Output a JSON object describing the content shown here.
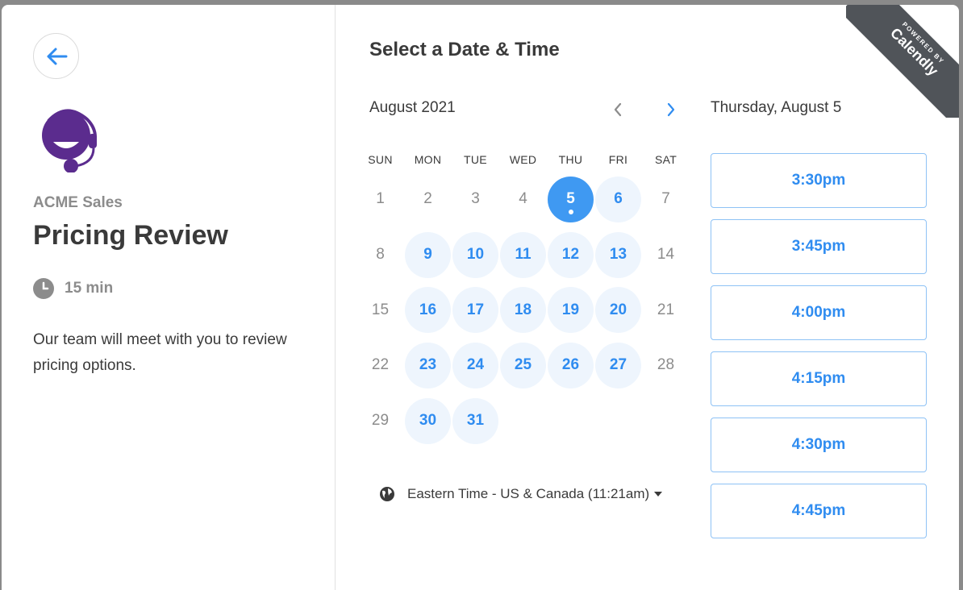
{
  "organizer": {
    "name": "ACME Sales",
    "event_title": "Pricing Review",
    "duration": "15 min",
    "description": "Our team will meet with you to review pricing options.",
    "brand_color": "#5b2c8e"
  },
  "scheduler": {
    "title": "Select a Date & Time",
    "month": "August 2021",
    "weekdays": [
      "SUN",
      "MON",
      "TUE",
      "WED",
      "THU",
      "FRI",
      "SAT"
    ],
    "selected_date_label": "Thursday, August 5",
    "timezone_label": "Eastern Time - US & Canada (11:21am)",
    "days": [
      {
        "n": "1",
        "state": "disabled"
      },
      {
        "n": "2",
        "state": "disabled"
      },
      {
        "n": "3",
        "state": "disabled"
      },
      {
        "n": "4",
        "state": "disabled"
      },
      {
        "n": "5",
        "state": "selected"
      },
      {
        "n": "6",
        "state": "available"
      },
      {
        "n": "7",
        "state": "disabled"
      },
      {
        "n": "8",
        "state": "disabled"
      },
      {
        "n": "9",
        "state": "available"
      },
      {
        "n": "10",
        "state": "available"
      },
      {
        "n": "11",
        "state": "available"
      },
      {
        "n": "12",
        "state": "available"
      },
      {
        "n": "13",
        "state": "available"
      },
      {
        "n": "14",
        "state": "disabled"
      },
      {
        "n": "15",
        "state": "disabled"
      },
      {
        "n": "16",
        "state": "available"
      },
      {
        "n": "17",
        "state": "available"
      },
      {
        "n": "18",
        "state": "available"
      },
      {
        "n": "19",
        "state": "available"
      },
      {
        "n": "20",
        "state": "available"
      },
      {
        "n": "21",
        "state": "disabled"
      },
      {
        "n": "22",
        "state": "disabled"
      },
      {
        "n": "23",
        "state": "available"
      },
      {
        "n": "24",
        "state": "available"
      },
      {
        "n": "25",
        "state": "available"
      },
      {
        "n": "26",
        "state": "available"
      },
      {
        "n": "27",
        "state": "available"
      },
      {
        "n": "28",
        "state": "disabled"
      },
      {
        "n": "29",
        "state": "disabled"
      },
      {
        "n": "30",
        "state": "available"
      },
      {
        "n": "31",
        "state": "available"
      }
    ],
    "time_slots": [
      "3:30pm",
      "3:45pm",
      "4:00pm",
      "4:15pm",
      "4:30pm",
      "4:45pm"
    ]
  },
  "badge": {
    "small_text": "POWERED BY",
    "brand_text": "Calendly"
  },
  "colors": {
    "accent": "#2f8cf0",
    "selected_day": "#3f99f2",
    "available_day_bg": "#eef5fd",
    "ribbon": "#505459"
  },
  "icons": {
    "back": "arrow-left-icon",
    "clock": "clock-icon",
    "globe": "globe-icon",
    "prev": "chevron-left-icon",
    "next": "chevron-right-icon",
    "caret": "caret-down-icon"
  }
}
